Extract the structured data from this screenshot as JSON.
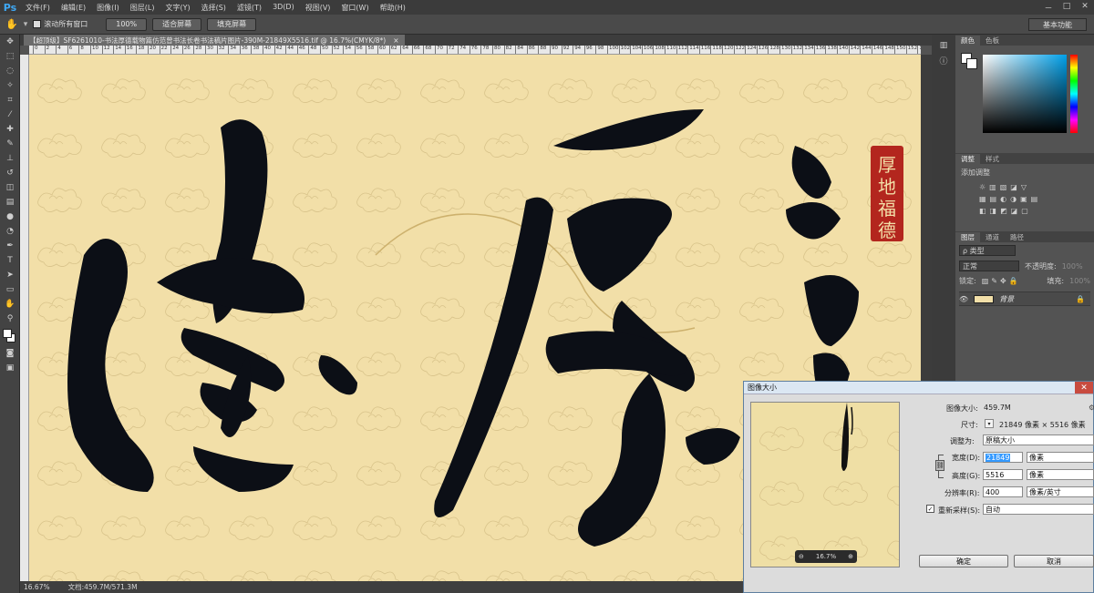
{
  "app": {
    "logo": "Ps"
  },
  "menu": [
    "文件(F)",
    "编辑(E)",
    "图像(I)",
    "图层(L)",
    "文字(Y)",
    "选择(S)",
    "滤镜(T)",
    "3D(D)",
    "视图(V)",
    "窗口(W)",
    "帮助(H)"
  ],
  "window_controls": [
    "－",
    "□",
    "✕"
  ],
  "options": {
    "scroll_all": "滚动所有窗口",
    "btn_100": "100%",
    "btn_fit": "适合屏幕",
    "btn_fill": "填充屏幕",
    "workspace": "基本功能"
  },
  "document": {
    "tab_title": "【超顶级】SF6261010-书法厚德载物篇仿范曾书法长卷书法稿片图片-390M-21849X5516.tif @ 16.7%(CMYK/8*)",
    "tab_close": "×"
  },
  "ruler_ticks": [
    "0",
    "2",
    "4",
    "6",
    "8",
    "10",
    "12",
    "14",
    "16",
    "18",
    "20",
    "22",
    "24",
    "26",
    "28",
    "30",
    "32",
    "34",
    "36",
    "38",
    "40",
    "42",
    "44",
    "46",
    "48",
    "50",
    "52",
    "54",
    "56",
    "58",
    "60",
    "62",
    "64",
    "66",
    "68",
    "70",
    "72",
    "74",
    "76",
    "78",
    "80",
    "82",
    "84",
    "86",
    "88",
    "90",
    "92",
    "94",
    "96",
    "98",
    "100",
    "102",
    "104",
    "106",
    "108",
    "110",
    "112",
    "114",
    "116",
    "118",
    "120",
    "122",
    "124",
    "126",
    "128",
    "130",
    "132",
    "134",
    "136",
    "138",
    "140",
    "142",
    "144",
    "146",
    "148",
    "150",
    "152",
    "154"
  ],
  "canvas": {
    "background": "#f2dfa8",
    "seal_text": "厚地福德"
  },
  "status": {
    "zoom": "16.67%",
    "doc": "文档:459.7M/571.3M"
  },
  "panels": {
    "color_tabs": [
      "颜色",
      "色板"
    ],
    "adjust_tabs": [
      "调整",
      "样式"
    ],
    "adjust_title": "添加调整",
    "layer_tabs": [
      "图层",
      "通道",
      "路径"
    ],
    "kind_filter": "ρ 类型",
    "blend_mode": "正常",
    "opacity_label": "不透明度:",
    "opacity_value": "100%",
    "lock_label": "锁定:",
    "fill_label": "填充:",
    "fill_value": "100%",
    "layer_name": "背景",
    "bottom_icons": [
      "∞",
      "fx",
      "◐",
      "▢",
      "⬚",
      "🗑"
    ]
  },
  "dialog": {
    "title": "图像大小",
    "close": "✕",
    "preview_zoom": "16.7%",
    "image_size_label": "图像大小:",
    "image_size_value": "459.7M",
    "dims_label": "尺寸:",
    "dims_value": "21849 像素 × 5516 像素",
    "fit_label": "调整为:",
    "fit_value": "原稿大小",
    "width_label": "宽度(D):",
    "width_value": "21849",
    "width_unit": "像素",
    "height_label": "高度(G):",
    "height_value": "5516",
    "height_unit": "像素",
    "res_label": "分辨率(R):",
    "res_value": "400",
    "res_unit": "像素/英寸",
    "resample_label": "重新采样(S):",
    "resample_value": "自动",
    "ok": "确定",
    "cancel": "取消"
  }
}
